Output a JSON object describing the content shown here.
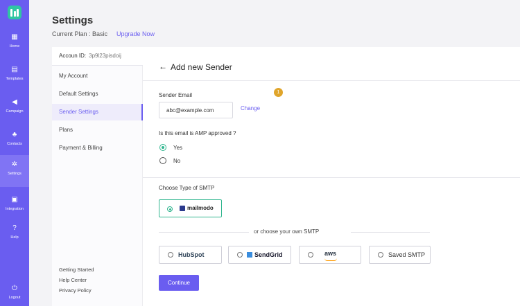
{
  "sidebar": {
    "items": [
      {
        "label": "Home",
        "icon": "grid-icon"
      },
      {
        "label": "Templates",
        "icon": "document-icon"
      },
      {
        "label": "Campaign",
        "icon": "megaphone-icon"
      },
      {
        "label": "Contacts",
        "icon": "contacts-icon"
      },
      {
        "label": "Settings",
        "icon": "gear-icon"
      },
      {
        "label": "Integration",
        "icon": "plug-icon"
      },
      {
        "label": "Help",
        "icon": "question-icon"
      },
      {
        "label": "Logout",
        "icon": "power-icon"
      }
    ],
    "active": "Settings",
    "color": "#6a5df0"
  },
  "header": {
    "title": "Settings",
    "plan_label": "Current Plan : Basic",
    "upgrade": "Upgrade Now"
  },
  "settings_menu": {
    "account_label": "Accoun ID:",
    "account_id": "3p9l23pisdoij",
    "items": [
      "My Account",
      "Default Settings",
      "Sender Settings",
      "Plans",
      "Payment & Billing"
    ],
    "active": "Sender Settings",
    "footer": [
      "Getting Started",
      "Help Center",
      "Privacy Policy"
    ]
  },
  "sender": {
    "title": "Add new Sender",
    "email_label": "Sender Email",
    "email_value": "abc@example.com",
    "change": "Change",
    "badge": "1",
    "amp_question": "Is this email is AMP approved ?",
    "amp_options": [
      "Yes",
      "No"
    ],
    "amp_selected": "Yes"
  },
  "smtp": {
    "label": "Choose Type of SMTP",
    "default_option": "mailmodo",
    "or_text": "or choose your own SMTP",
    "providers": [
      "HubSpot",
      "SendGrid",
      "aws",
      "Saved SMTP"
    ],
    "continue": "Continue"
  }
}
